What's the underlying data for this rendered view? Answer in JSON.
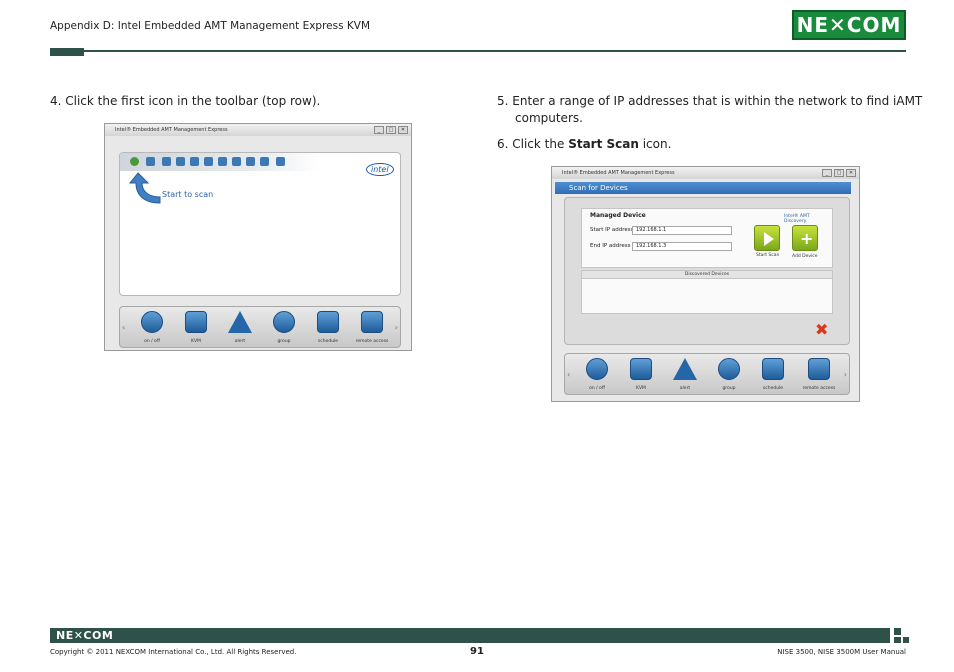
{
  "header": {
    "section_title": "Appendix D: Intel Embedded AMT Management Express KVM",
    "logo_text": "NE COM"
  },
  "steps": {
    "step4": "4.  Click the first icon in the toolbar (top row).",
    "step5_line1": "5.  Enter a range of IP addresses that is within the network to find iAMT",
    "step5_line2": "computers.",
    "step6_pre": "6.  Click the ",
    "step6_bold": "Start Scan",
    "step6_post": " icon."
  },
  "screenshot1": {
    "window_title": "Intel® Embedded AMT Management Express",
    "start_to_scan": "Start to scan",
    "intel_logo": "intel",
    "dock": [
      "on / off",
      "KVM",
      "alert",
      "group",
      "schedule",
      "remote access"
    ]
  },
  "screenshot2": {
    "window_title": "Intel® Embedded AMT Management Express",
    "panel_title": "Scan for Devices",
    "managed_device": "Managed Device",
    "amt_discovery": "Intel® AMT Discovery",
    "start_ip_label": "Start IP address",
    "start_ip_value": "192.168.1.1",
    "end_ip_label": "End IP address",
    "end_ip_value": "192.168.1.3",
    "start_scan": "Start Scan",
    "add_device": "Add Device",
    "discovered_devices": "Discovered Devices",
    "dock": [
      "on / off",
      "KVM",
      "alert",
      "group",
      "schedule",
      "remote access"
    ]
  },
  "footer": {
    "logo_text": "NE COM",
    "copyright": "Copyright © 2011 NEXCOM International Co., Ltd. All Rights Reserved.",
    "page_number": "91",
    "manual": "NISE 3500, NISE 3500M User Manual"
  },
  "colors": {
    "brand_green": "#1a8a3c",
    "rule_dark": "#2e5249",
    "accent_blue": "#2e6db4"
  }
}
